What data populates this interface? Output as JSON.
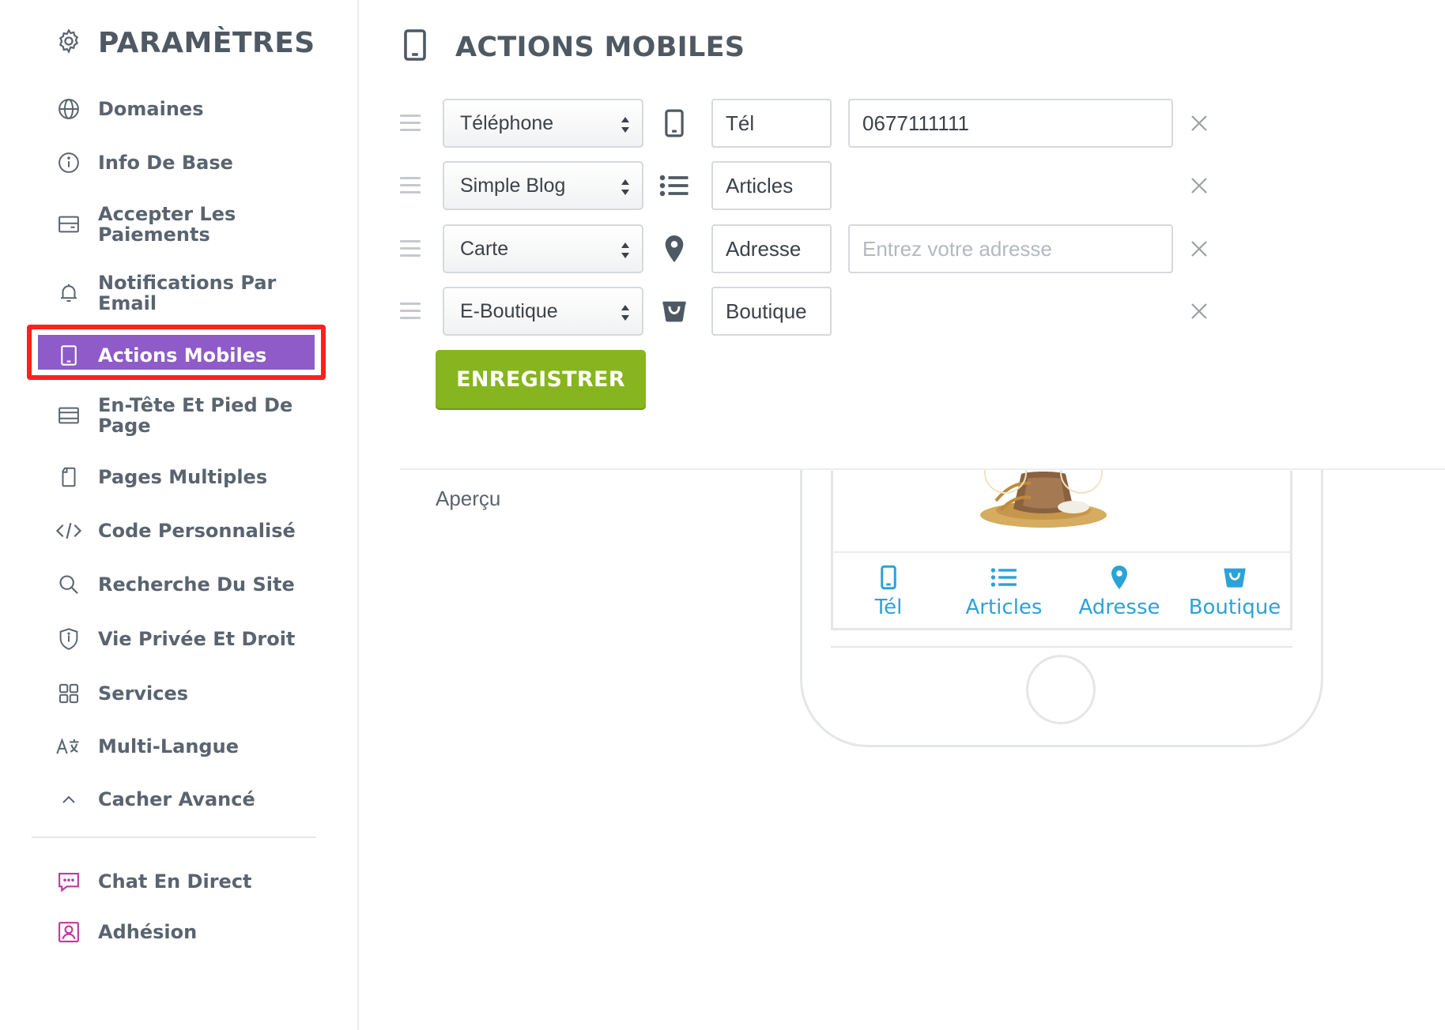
{
  "sidebar": {
    "title": "PARAMÈTRES",
    "items": [
      {
        "label": "Domaines",
        "icon": "globe-icon"
      },
      {
        "label": "Info De Base",
        "icon": "info-icon"
      },
      {
        "label": "Accepter Les Paiements",
        "icon": "card-icon"
      },
      {
        "label": "Notifications Par Email",
        "icon": "bell-icon"
      },
      {
        "label": "Actions Mobiles",
        "icon": "tablet-icon",
        "active": true
      },
      {
        "label": "En-Tête Et Pied De Page",
        "icon": "layout-icon"
      },
      {
        "label": "Pages Multiples",
        "icon": "pages-icon"
      },
      {
        "label": "Code Personnalisé",
        "icon": "code-icon"
      },
      {
        "label": "Recherche Du Site",
        "icon": "search-icon"
      },
      {
        "label": "Vie Privée Et Droit",
        "icon": "shield-icon"
      },
      {
        "label": "Services",
        "icon": "grid-icon"
      },
      {
        "label": "Multi-Langue",
        "icon": "translate-icon"
      },
      {
        "label": "Cacher Avancé",
        "icon": "chevron-up-icon"
      }
    ],
    "extra_items": [
      {
        "label": "Chat En Direct",
        "icon": "chat-icon"
      },
      {
        "label": "Adhésion",
        "icon": "member-icon"
      }
    ]
  },
  "main": {
    "title": "ACTIONS MOBILES",
    "rows": [
      {
        "type": "Téléphone",
        "icon": "phone-icon",
        "label": "Tél",
        "value": "0677111111",
        "placeholder": ""
      },
      {
        "type": "Simple Blog",
        "icon": "list-icon",
        "label": "Articles"
      },
      {
        "type": "Carte",
        "icon": "map-pin-icon",
        "label": "Adresse",
        "value": "",
        "placeholder": "Entrez votre adresse"
      },
      {
        "type": "E-Boutique",
        "icon": "shop-bag-icon",
        "label": "Boutique"
      }
    ],
    "save_label": "ENREGISTRER",
    "preview_label": "Aperçu"
  },
  "preview": {
    "tabs": [
      {
        "label": "Tél",
        "icon": "phone-icon"
      },
      {
        "label": "Articles",
        "icon": "list-icon"
      },
      {
        "label": "Adresse",
        "icon": "map-pin-icon"
      },
      {
        "label": "Boutique",
        "icon": "shop-bag-icon"
      }
    ]
  },
  "colors": {
    "accent": "#8e5bc8",
    "highlight": "#ff1f1f",
    "save": "#86b51f",
    "preview_tab": "#2ba3d6",
    "extra_icon": "#c0399c"
  }
}
